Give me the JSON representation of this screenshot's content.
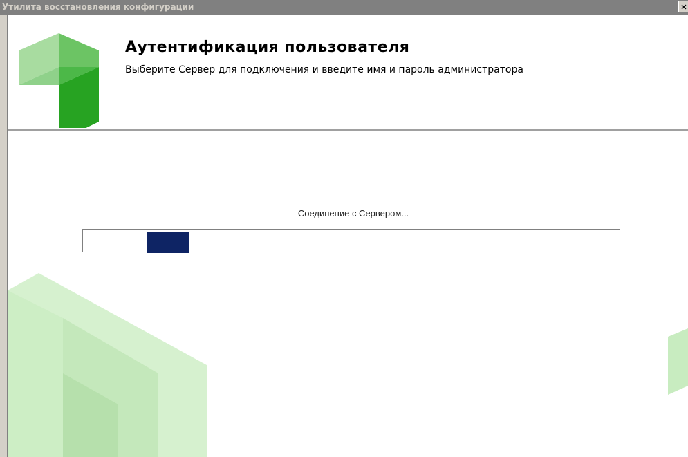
{
  "window": {
    "title": "Утилита восстановления конфигурации",
    "close_label": "×"
  },
  "header": {
    "title": "Аутентификация пользователя",
    "subtitle": "Выберите Сервер для подключения и введите имя и пароль администратора"
  },
  "main": {
    "status_text": "Соединение с Сервером...",
    "progress_mode": "marquee"
  },
  "colors": {
    "logo_light": "#8fd18a",
    "logo_dark": "#2ea62a",
    "progress_chunk": "#0e2464",
    "titlebar": "#808080",
    "decor_green": "#c8ecc0"
  },
  "icons": {
    "logo": "app-logo-icon",
    "close": "close-icon"
  }
}
